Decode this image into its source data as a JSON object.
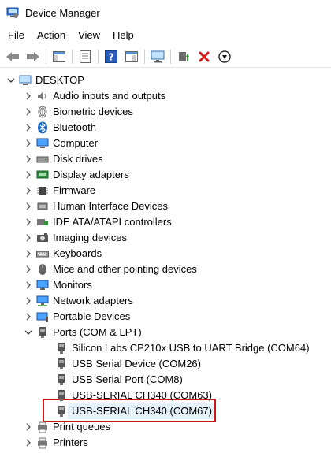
{
  "window": {
    "title": "Device Manager"
  },
  "menu": {
    "file": "File",
    "action": "Action",
    "view": "View",
    "help": "Help"
  },
  "tree": {
    "root": "DESKTOP",
    "categories": {
      "audio": "Audio inputs and outputs",
      "biometric": "Biometric devices",
      "bluetooth": "Bluetooth",
      "computer": "Computer",
      "disk": "Disk drives",
      "display": "Display adapters",
      "firmware": "Firmware",
      "hid": "Human Interface Devices",
      "ide": "IDE ATA/ATAPI controllers",
      "imaging": "Imaging devices",
      "keyboards": "Keyboards",
      "mice": "Mice and other pointing devices",
      "monitors": "Monitors",
      "network": "Network adapters",
      "portable": "Portable Devices",
      "ports": "Ports (COM & LPT)",
      "printqueues": "Print queues",
      "printers": "Printers"
    },
    "ports": [
      "Silicon Labs CP210x USB to UART Bridge (COM64)",
      "USB Serial Device (COM26)",
      "USB Serial Port (COM8)",
      "USB-SERIAL CH340 (COM63)",
      "USB-SERIAL CH340 (COM67)"
    ]
  },
  "colors": {
    "highlight": "#d0131d",
    "selection": "#e5f1fb"
  }
}
